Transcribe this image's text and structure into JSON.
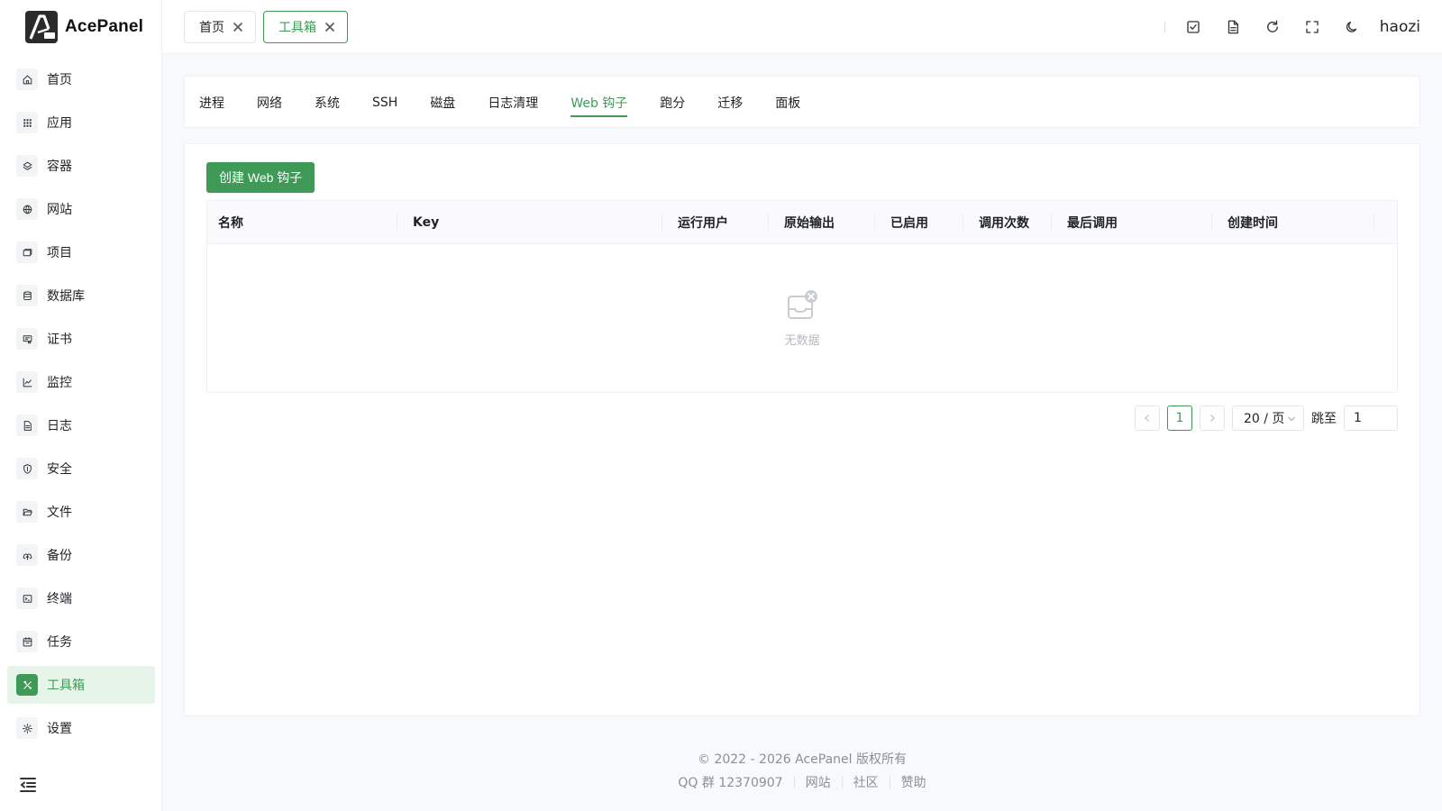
{
  "app": {
    "name": "AcePanel"
  },
  "sidebar": {
    "items": [
      {
        "label": "首页",
        "icon": "home-icon"
      },
      {
        "label": "应用",
        "icon": "apps-grid-icon"
      },
      {
        "label": "容器",
        "icon": "layers-icon"
      },
      {
        "label": "网站",
        "icon": "globe-icon"
      },
      {
        "label": "项目",
        "icon": "folders-icon"
      },
      {
        "label": "数据库",
        "icon": "database-icon"
      },
      {
        "label": "证书",
        "icon": "certificate-icon"
      },
      {
        "label": "监控",
        "icon": "chart-line-icon"
      },
      {
        "label": "日志",
        "icon": "file-text-icon"
      },
      {
        "label": "安全",
        "icon": "shield-icon"
      },
      {
        "label": "文件",
        "icon": "folder-open-icon"
      },
      {
        "label": "备份",
        "icon": "cloud-upload-icon"
      },
      {
        "label": "终端",
        "icon": "terminal-icon"
      },
      {
        "label": "任务",
        "icon": "calendar-task-icon"
      },
      {
        "label": "工具箱",
        "icon": "tools-icon",
        "active": true
      },
      {
        "label": "设置",
        "icon": "gear-icon"
      }
    ]
  },
  "header": {
    "tabs": [
      {
        "label": "首页",
        "active": false
      },
      {
        "label": "工具箱",
        "active": true
      }
    ],
    "username": "haozi"
  },
  "toolbox": {
    "subtabs": [
      "进程",
      "网络",
      "系统",
      "SSH",
      "磁盘",
      "日志清理",
      "Web 钩子",
      "跑分",
      "迁移",
      "面板"
    ],
    "active_subtab": "Web 钩子",
    "create_button": "创建 Web 钩子",
    "table": {
      "columns": [
        "名称",
        "Key",
        "运行用户",
        "原始输出",
        "已启用",
        "调用次数",
        "最后调用",
        "创建时间"
      ],
      "rows": [],
      "empty_text": "无数据"
    },
    "pagination": {
      "current_page": "1",
      "page_size": "20 / 页",
      "jump_label": "跳至",
      "jump_value": "1"
    }
  },
  "footer": {
    "copyright": "© 2022 - 2026 AcePanel 版权所有",
    "qq_group": "QQ 群 12370907",
    "links": [
      "网站",
      "社区",
      "赞助"
    ]
  },
  "colors": {
    "accent": "#3f9a57",
    "accent_light": "#e7f4ea"
  }
}
